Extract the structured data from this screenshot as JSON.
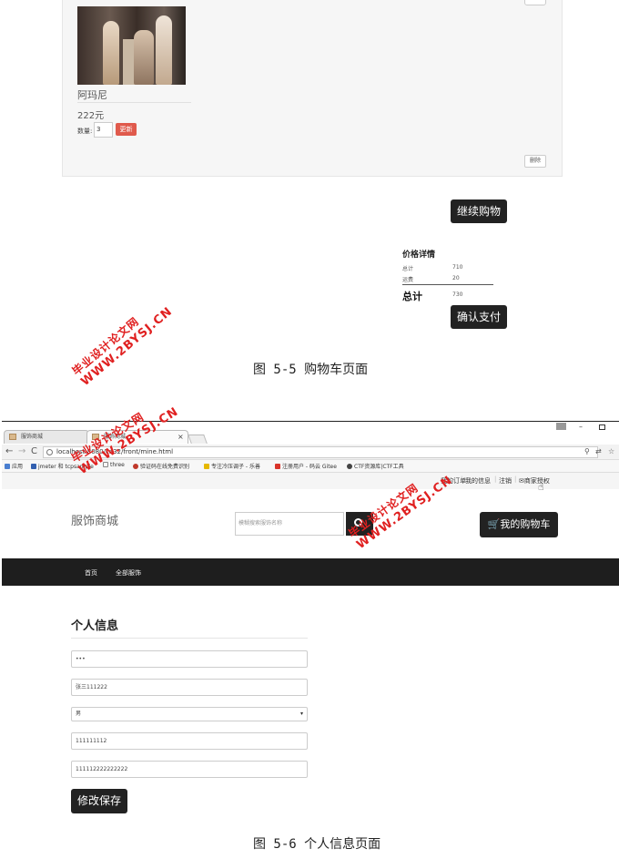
{
  "cart": {
    "product_name": "阿玛尼",
    "product_price": "222元",
    "qty_label": "数量:",
    "qty_value": "3",
    "update_label": "更新",
    "delete_label": "删除",
    "continue_label": "继续购物",
    "price_details": {
      "title": "价格详情",
      "subtotal_label": "总计",
      "subtotal_value": "710",
      "shipping_label": "运费",
      "shipping_value": "20",
      "total_label": "总计",
      "total_value": "730"
    },
    "pay_label": "确认支付"
  },
  "captions": {
    "fig1": "图 5-5 购物车页面",
    "fig2": "图 5-6 个人信息页面"
  },
  "watermark": {
    "line1": "毕业设计论文网",
    "line2": "WWW.2BYSJ.CN"
  },
  "browser": {
    "tabs": [
      {
        "label": "服饰商城"
      },
      {
        "label": "服饰商城"
      }
    ],
    "tab_close": "×",
    "url": "localhost:8080/ca32/front/mine.html",
    "bookmarks": [
      {
        "label": "应用"
      },
      {
        "label": "jmeter 和 tcpsample"
      },
      {
        "label": "three"
      },
      {
        "label": "验证码在线免费识别"
      },
      {
        "label": "专注冷压调子 - 乐善"
      },
      {
        "label": "注册用户 - 码云 Gitee"
      },
      {
        "label": "CTF资源库|CTF工具"
      }
    ]
  },
  "userbar": {
    "links": [
      {
        "label": "我的订单"
      },
      {
        "label": "我的信息"
      },
      {
        "label": "注销"
      },
      {
        "label": "✉商家授权"
      }
    ]
  },
  "site": {
    "title": "服饰商城",
    "search_placeholder": "模糊搜索服饰名称",
    "cart_label": "🛒我的购物车",
    "nav": [
      {
        "label": "首页"
      },
      {
        "label": "全部服饰"
      }
    ]
  },
  "profile": {
    "title": "个人信息",
    "password_value": "•••",
    "name_value": "张三111222",
    "gender_value": "男",
    "phone_value": "111111112",
    "address_value": "111112222222222",
    "save_label": "修改保存"
  }
}
